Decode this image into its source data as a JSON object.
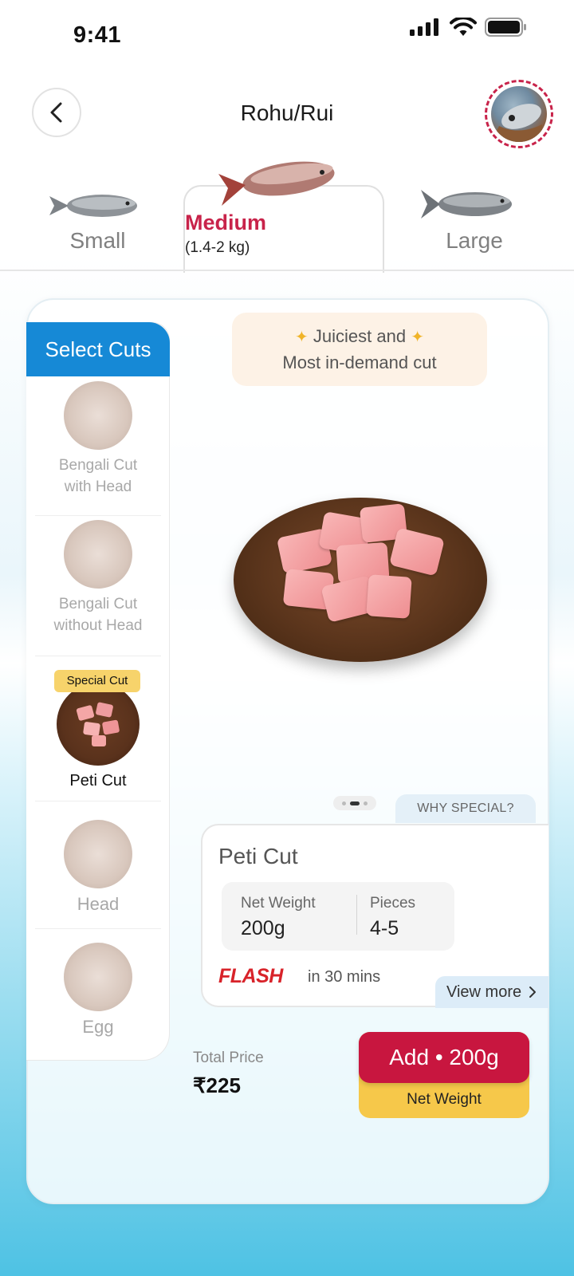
{
  "status_bar": {
    "time": "9:41"
  },
  "header": {
    "title": "Rohu/Rui"
  },
  "size_tabs": {
    "small": "Small",
    "medium": "Medium",
    "medium_weight": "(1.4-2 kg)",
    "large": "Large"
  },
  "cuts": {
    "header": "Select Cuts",
    "items": [
      {
        "label": "Bengali Cut with Head",
        "lines": [
          "Bengali Cut",
          "with Head"
        ]
      },
      {
        "label": "Bengali Cut without Head",
        "lines": [
          "Bengali Cut",
          "without Head"
        ]
      },
      {
        "label": "Peti Cut",
        "lines": [
          "Peti Cut"
        ],
        "badge": "Special Cut",
        "selected": true
      },
      {
        "label": "Head",
        "lines": [
          "Head"
        ]
      },
      {
        "label": "Egg",
        "lines": [
          "Egg"
        ]
      }
    ]
  },
  "banner": {
    "line1": "Juiciest and",
    "line2": "Most in-demand cut"
  },
  "carousel": {
    "pages": 3,
    "current": 2
  },
  "product": {
    "why_special": "WHY SPECIAL?",
    "name": "Peti Cut",
    "net_weight_label": "Net Weight",
    "net_weight": "200g",
    "pieces_label": "Pieces",
    "pieces": "4-5",
    "flash_logo": "FLASH",
    "delivery": "in 30 mins",
    "view_more": "View more"
  },
  "footer": {
    "total_label": "Total Price",
    "total_value": "₹225",
    "add_button": "Add • 200g",
    "add_sub": "Net Weight"
  },
  "colors": {
    "accent": "#c8163f",
    "tab_blue": "#1689d6",
    "badge_yellow": "#f7d36b",
    "flash_red": "#d8232a"
  }
}
